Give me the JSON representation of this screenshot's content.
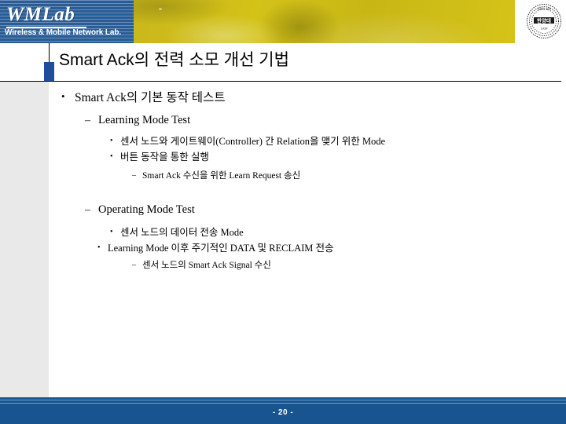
{
  "header": {
    "logo_title": "WMLab",
    "logo_subtitle": "Wireless & Mobile Network Lab.",
    "seal_center_text": "한양대",
    "seal_top_text": "사랑의 실천",
    "seal_bottom_text": "1939",
    "colors": {
      "banner_blue": "#2a5d96",
      "banner_yellow": "#cfbd18"
    }
  },
  "slide": {
    "title": "Smart Ack의 전력 소모 개선 기법",
    "title_accent_color": "#1f4e9c"
  },
  "outline": [
    {
      "level": 1,
      "bullet": "•",
      "text": "Smart Ack의 기본 동작 테스트"
    },
    {
      "level": 2,
      "bullet": "–",
      "text": "Learning Mode Test"
    },
    {
      "level": 3,
      "bullet": "•",
      "text": "센서 노드와 게이트웨이(Controller) 간 Relation을 맺기 위한 Mode"
    },
    {
      "level": 3,
      "bullet": "•",
      "text": "버튼 동작을 통한 실행"
    },
    {
      "level": 4,
      "bullet": "–",
      "text": "Smart Ack 수신을 위한 Learn Request 송신"
    },
    {
      "level": 2,
      "bullet": "–",
      "text": "Operating Mode Test"
    },
    {
      "level": 3,
      "bullet": "•",
      "text": "센서 노드의 데이터 전송 Mode"
    },
    {
      "level": 3,
      "bullet": "•",
      "text": "Learning Mode 이후 주기적인 DATA 및 RECLAIM 전송"
    },
    {
      "level": 4,
      "bullet": "–",
      "text": "센서 노드의 Smart Ack Signal 수신"
    }
  ],
  "footer": {
    "page_number": "- 20 -",
    "band_color": "#18548f"
  }
}
